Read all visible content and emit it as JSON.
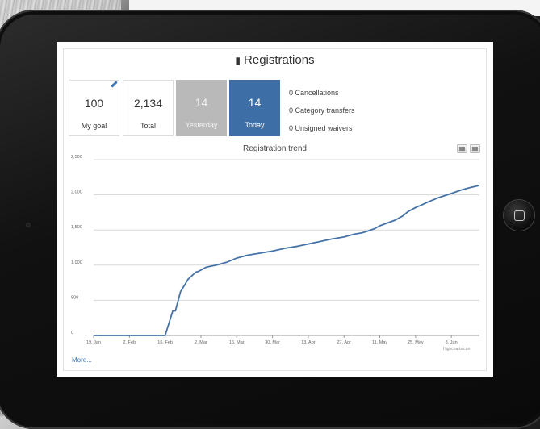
{
  "dashboard": {
    "title": "Registrations",
    "tiles": {
      "goal": {
        "value": "100",
        "label": "My goal"
      },
      "total": {
        "value": "2,134",
        "label": "Total"
      },
      "yesterday": {
        "value": "14",
        "label": "Yesterday"
      },
      "today": {
        "value": "14",
        "label": "Today"
      }
    },
    "stats": [
      "0 Cancellations",
      "0 Category transfers",
      "0 Unsigned waivers"
    ],
    "more_link": "More...",
    "credit": "Highcharts.com",
    "colors": {
      "accent": "#3d6ea5",
      "yesterday_tile": "#b9b9b9",
      "line": "#4572a7"
    },
    "icons": [
      "registrations-icon",
      "edit-pencil-icon",
      "print-icon",
      "download-icon",
      "home-button-icon"
    ]
  },
  "chart_data": {
    "type": "line",
    "title": "Registration trend",
    "ylim": [
      0,
      2500
    ],
    "y_ticks": [
      "0",
      "500",
      "1,000",
      "1,500",
      "2,000",
      "2,500"
    ],
    "x_ticks": [
      "19. Jan",
      "2. Feb",
      "16. Feb",
      "2. Mar",
      "16. Mar",
      "30. Mar",
      "13. Apr",
      "27. Apr",
      "11. May",
      "25. May",
      "8. Jun"
    ],
    "grid": true,
    "legend": "none",
    "series": [
      {
        "x": [
          "2014-01-19",
          "2014-02-16",
          "2014-02-19",
          "2014-02-20",
          "2014-02-22",
          "2014-02-25",
          "2014-02-28",
          "2014-03-01",
          "2014-03-04",
          "2014-03-08",
          "2014-03-12",
          "2014-03-16",
          "2014-03-20",
          "2014-03-25",
          "2014-03-30",
          "2014-04-04",
          "2014-04-09",
          "2014-04-13",
          "2014-04-18",
          "2014-04-22",
          "2014-04-27",
          "2014-05-01",
          "2014-05-04",
          "2014-05-06",
          "2014-05-09",
          "2014-05-11",
          "2014-05-14",
          "2014-05-17",
          "2014-05-20",
          "2014-05-22",
          "2014-05-25",
          "2014-05-27",
          "2014-05-30",
          "2014-06-03",
          "2014-06-08",
          "2014-06-12",
          "2014-06-15",
          "2014-06-19"
        ],
        "y": [
          0,
          0,
          350,
          350,
          620,
          800,
          900,
          910,
          970,
          1000,
          1040,
          1100,
          1140,
          1170,
          1200,
          1240,
          1270,
          1300,
          1340,
          1370,
          1400,
          1440,
          1460,
          1480,
          1520,
          1560,
          1600,
          1640,
          1700,
          1760,
          1820,
          1850,
          1900,
          1960,
          2020,
          2070,
          2100,
          2134
        ]
      }
    ]
  }
}
